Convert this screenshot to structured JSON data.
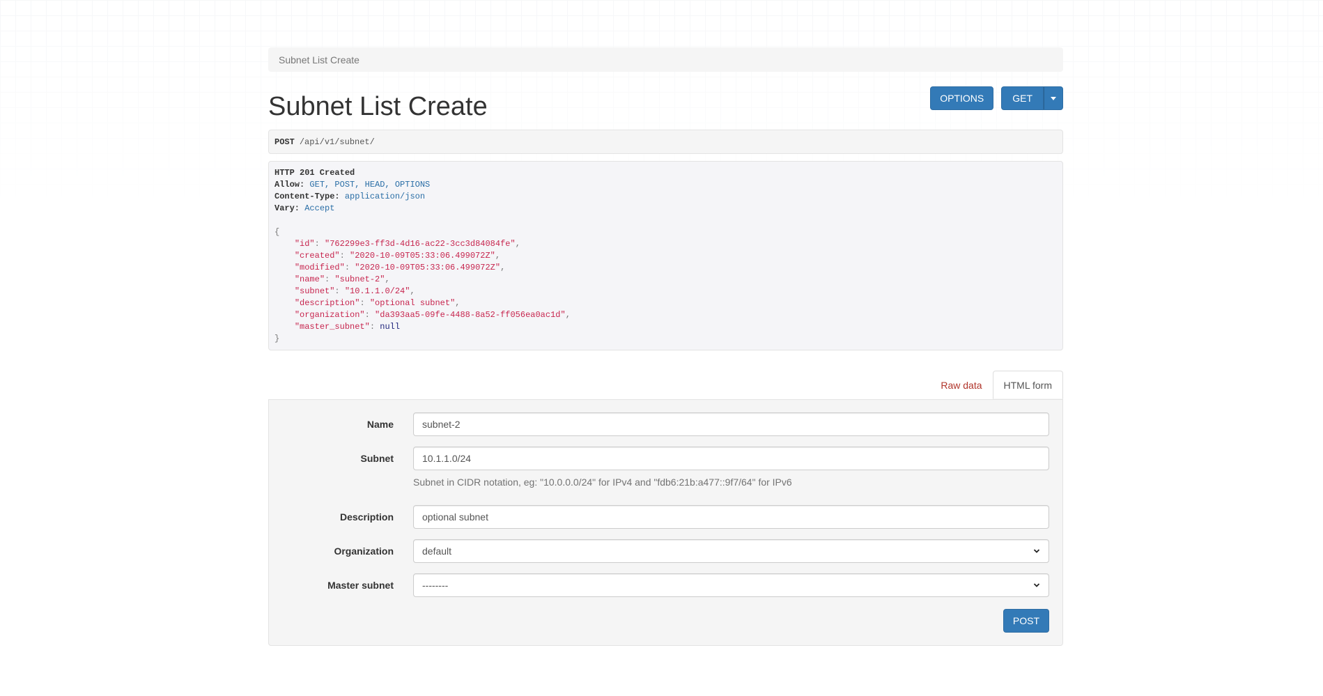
{
  "breadcrumb": {
    "current": "Subnet List Create"
  },
  "header": {
    "title": "Subnet List Create",
    "options_label": "OPTIONS",
    "get_label": "GET"
  },
  "request": {
    "method": "POST",
    "path": "/api/v1/subnet/"
  },
  "response": {
    "status": "HTTP 201 Created",
    "headers": [
      {
        "key": "Allow:",
        "value": "GET, POST, HEAD, OPTIONS"
      },
      {
        "key": "Content-Type:",
        "value": "application/json"
      },
      {
        "key": "Vary:",
        "value": "Accept"
      }
    ],
    "body": [
      {
        "key": "\"id\"",
        "value": "\"762299e3-ff3d-4d16-ac22-3cc3d84084fe\""
      },
      {
        "key": "\"created\"",
        "value": "\"2020-10-09T05:33:06.499072Z\""
      },
      {
        "key": "\"modified\"",
        "value": "\"2020-10-09T05:33:06.499072Z\""
      },
      {
        "key": "\"name\"",
        "value": "\"subnet-2\""
      },
      {
        "key": "\"subnet\"",
        "value": "\"10.1.1.0/24\""
      },
      {
        "key": "\"description\"",
        "value": "\"optional subnet\""
      },
      {
        "key": "\"organization\"",
        "value": "\"da393aa5-09fe-4488-8a52-ff056ea0ac1d\""
      },
      {
        "key": "\"master_subnet\"",
        "value": "null"
      }
    ]
  },
  "tabs": {
    "raw_data": "Raw data",
    "html_form": "HTML form"
  },
  "form": {
    "name_label": "Name",
    "name_value": "subnet-2",
    "subnet_label": "Subnet",
    "subnet_value": "10.1.1.0/24",
    "subnet_help": "Subnet in CIDR notation, eg: \"10.0.0.0/24\" for IPv4 and \"fdb6:21b:a477::9f7/64\" for IPv6",
    "description_label": "Description",
    "description_value": "optional subnet",
    "organization_label": "Organization",
    "organization_value": "default",
    "master_subnet_label": "Master subnet",
    "master_subnet_value": "--------",
    "post_label": "POST"
  },
  "colors": {
    "primary": "#337ab7",
    "json_string": "#c7254e",
    "json_null": "#21267d",
    "header_value": "#2a6ea6",
    "raw_tab": "#b0342a"
  }
}
